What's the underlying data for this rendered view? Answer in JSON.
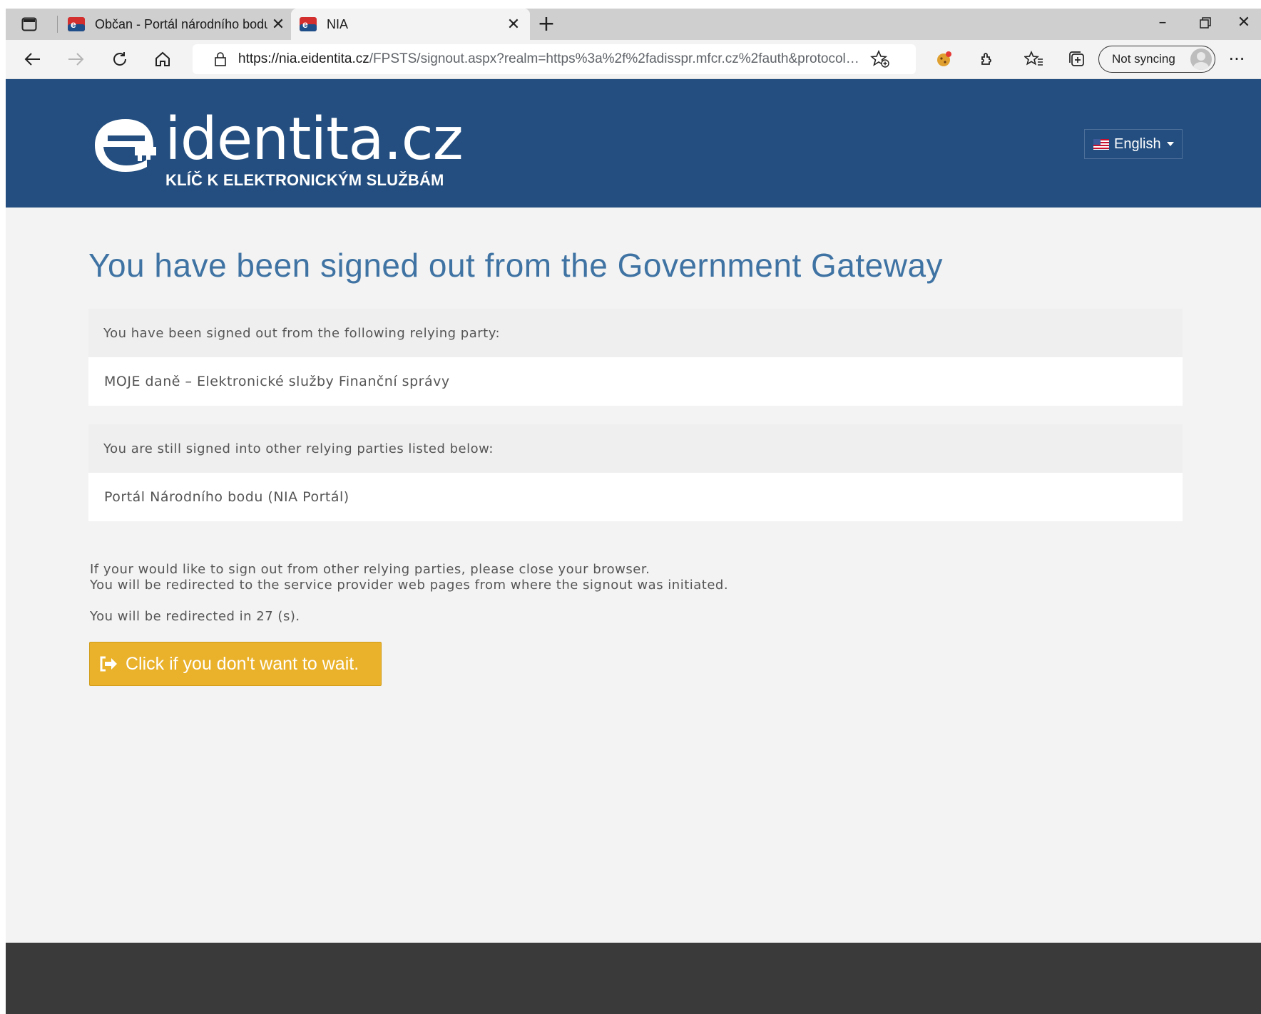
{
  "browser": {
    "tabs": [
      {
        "title": "Občan - Portál národního bodu",
        "active": false
      },
      {
        "title": "NIA",
        "active": true
      }
    ],
    "url_host": "https://nia.eidentita.cz",
    "url_path": "/FPSTS/signout.aspx?realm=https%3a%2f%2fadisspr.mfcr.cz%2fauth&protocol=...",
    "profile_label": "Not syncing",
    "icons": [
      "sidebar-icon",
      "back-icon",
      "forward-icon",
      "refresh-icon",
      "home-icon",
      "lock-icon",
      "favorite-add-icon",
      "extension-cookie-icon",
      "extensions-icon",
      "favorites-icon",
      "collections-icon",
      "more-icon",
      "minimize-icon",
      "restore-icon",
      "close-icon"
    ]
  },
  "header": {
    "logo_word": "identita.cz",
    "logo_tagline": "KLÍČ K ELEKTRONICKÝM SLUŽBÁM",
    "language": "English",
    "background": "#234e7f"
  },
  "main": {
    "title": "You have been signed out from the Government Gateway",
    "signed_out_heading": "You have been signed out from the following relying party:",
    "signed_out_party": "MOJE daně – Elektronické služby Finanční správy",
    "still_signed_heading": "You are still signed into other relying parties listed below:",
    "still_signed_party": "Portál Národního bodu (NIA Portál)",
    "info_line1": "If your would like to sign out from other relying parties, please close your browser.",
    "info_line2": "You will be redirected to the service provider web pages from where the signout was initiated.",
    "redirect_text": "You will be redirected in 27 (s).",
    "button_label": "Click if you don't want to wait.",
    "button_color": "#eab12a"
  }
}
